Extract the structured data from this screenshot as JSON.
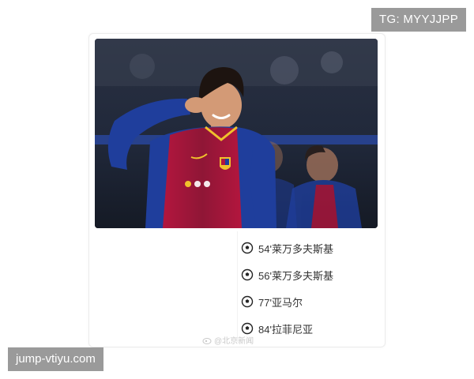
{
  "top_tag": "TG: MYYJJPP",
  "bottom_tag": "jump-vtiyu.com",
  "card": {
    "photo_alt": "",
    "events": [
      {
        "icon": "soccer-ball-icon",
        "text": "54'莱万多夫斯基"
      },
      {
        "icon": "soccer-ball-icon",
        "text": "56'莱万多夫斯基"
      },
      {
        "icon": "soccer-ball-icon",
        "text": "77'亚马尔"
      },
      {
        "icon": "soccer-ball-icon",
        "text": "84'拉菲尼亚"
      }
    ],
    "watermark": "@北京新闻"
  },
  "colors": {
    "tag_bg": "#9a9a9a",
    "jersey_blue": "#1f3e9c",
    "jersey_red": "#b3163e"
  }
}
